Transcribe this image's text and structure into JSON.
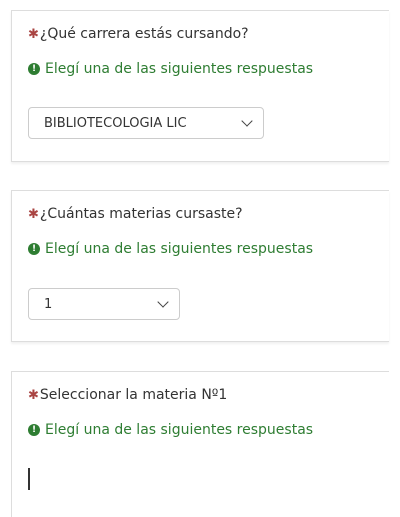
{
  "questions": [
    {
      "required_mark": "✱",
      "label": "¿Qué carrera estás cursando?",
      "hint": "Elegí una de las siguientes respuestas",
      "hint_icon": "exclamation-circle-icon",
      "selected_value": "BIBLIOTECOLOGIA LIC"
    },
    {
      "required_mark": "✱",
      "label": "¿Cuántas materias cursaste?",
      "hint": "Elegí una de las siguientes respuestas",
      "hint_icon": "exclamation-circle-icon",
      "selected_value": "1"
    },
    {
      "required_mark": "✱",
      "label": "Seleccionar la materia Nº1",
      "hint": "Elegí una de las siguientes respuestas",
      "hint_icon": "exclamation-circle-icon",
      "selected_value": ""
    }
  ],
  "colors": {
    "required": "#a94442",
    "hint": "#2e7d32",
    "text": "#333333",
    "border": "#cccccc"
  }
}
